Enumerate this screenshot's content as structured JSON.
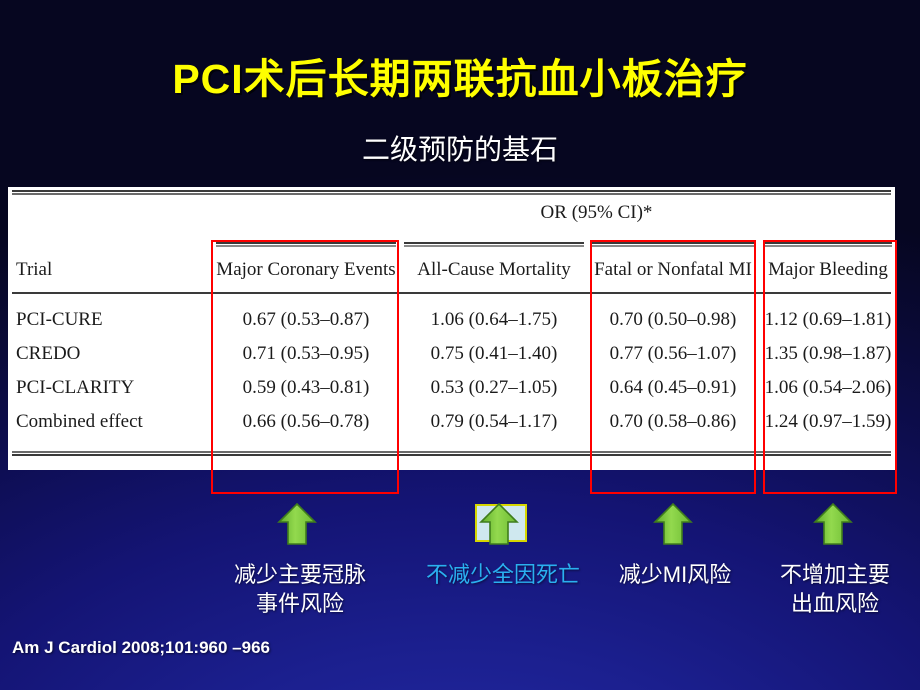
{
  "slide": {
    "title_main": "PCI术后长期两联抗血小板治疗",
    "title_sub": "二级预防的基石",
    "citation": "Am J Cardiol 2008;101:960 –966",
    "title_color": "#ffff00",
    "subtitle_color": "#ffffff",
    "background_color": "#141474",
    "highlight_color": "#ff0000",
    "arrow_color": "#7ed13f",
    "accent_caption_color": "#2ab0f0"
  },
  "table": {
    "span_header": "OR (95% CI)*",
    "row_header": "Trial",
    "columns": [
      "Major Coronary Events",
      "All-Cause Mortality",
      "Fatal or Nonfatal MI",
      "Major Bleeding"
    ],
    "rows": [
      {
        "trial": "PCI-CURE",
        "values": [
          "0.67 (0.53–0.87)",
          "1.06 (0.64–1.75)",
          "0.70 (0.50–0.98)",
          "1.12 (0.69–1.81)"
        ]
      },
      {
        "trial": "CREDO",
        "values": [
          "0.71 (0.53–0.95)",
          "0.75 (0.41–1.40)",
          "0.77 (0.56–1.07)",
          "1.35 (0.98–1.87)"
        ]
      },
      {
        "trial": "PCI-CLARITY",
        "values": [
          "0.59 (0.43–0.81)",
          "0.53 (0.27–1.05)",
          "0.64 (0.45–0.91)",
          "1.06 (0.54–2.06)"
        ]
      },
      {
        "trial": "Combined effect",
        "values": [
          "0.66 (0.56–0.78)",
          "0.79 (0.54–1.17)",
          "0.70 (0.58–0.86)",
          "1.24 (0.97–1.59)"
        ]
      }
    ]
  },
  "annotations": [
    {
      "icon": "up-arrow-icon",
      "caption": "减少主要冠脉\n事件风险",
      "emphasis": "normal"
    },
    {
      "icon": "up-arrow-icon",
      "caption": "不减少全因死亡",
      "emphasis": "accent"
    },
    {
      "icon": "up-arrow-icon",
      "caption": "减少MI风险",
      "emphasis": "normal"
    },
    {
      "icon": "up-arrow-icon",
      "caption": "不增加主要\n出血风险",
      "emphasis": "normal"
    }
  ],
  "chart_data": {
    "type": "table",
    "title": "OR (95% CI)*",
    "categories": [
      "Major Coronary Events",
      "All-Cause Mortality",
      "Fatal or Nonfatal MI",
      "Major Bleeding"
    ],
    "series": [
      {
        "name": "PCI-CURE",
        "values": [
          0.67,
          1.06,
          0.7,
          1.12
        ],
        "ci_low": [
          0.53,
          0.64,
          0.5,
          0.69
        ],
        "ci_high": [
          0.87,
          1.75,
          0.98,
          1.81
        ]
      },
      {
        "name": "CREDO",
        "values": [
          0.71,
          0.75,
          0.77,
          1.35
        ],
        "ci_low": [
          0.53,
          0.41,
          0.56,
          0.98
        ],
        "ci_high": [
          0.95,
          1.4,
          1.07,
          1.87
        ]
      },
      {
        "name": "PCI-CLARITY",
        "values": [
          0.59,
          0.53,
          0.64,
          1.06
        ],
        "ci_low": [
          0.43,
          0.27,
          0.45,
          0.54
        ],
        "ci_high": [
          0.81,
          1.05,
          0.91,
          2.06
        ]
      },
      {
        "name": "Combined effect",
        "values": [
          0.66,
          0.79,
          0.7,
          1.24
        ],
        "ci_low": [
          0.56,
          0.54,
          0.58,
          0.97
        ],
        "ci_high": [
          0.78,
          1.17,
          0.86,
          1.59
        ]
      }
    ],
    "xlabel": "Trial",
    "ylabel": "Odds Ratio",
    "highlighted_categories": [
      "Major Coronary Events",
      "Fatal or Nonfatal MI",
      "Major Bleeding"
    ],
    "source": "Am J Cardiol 2008;101:960 –966"
  }
}
